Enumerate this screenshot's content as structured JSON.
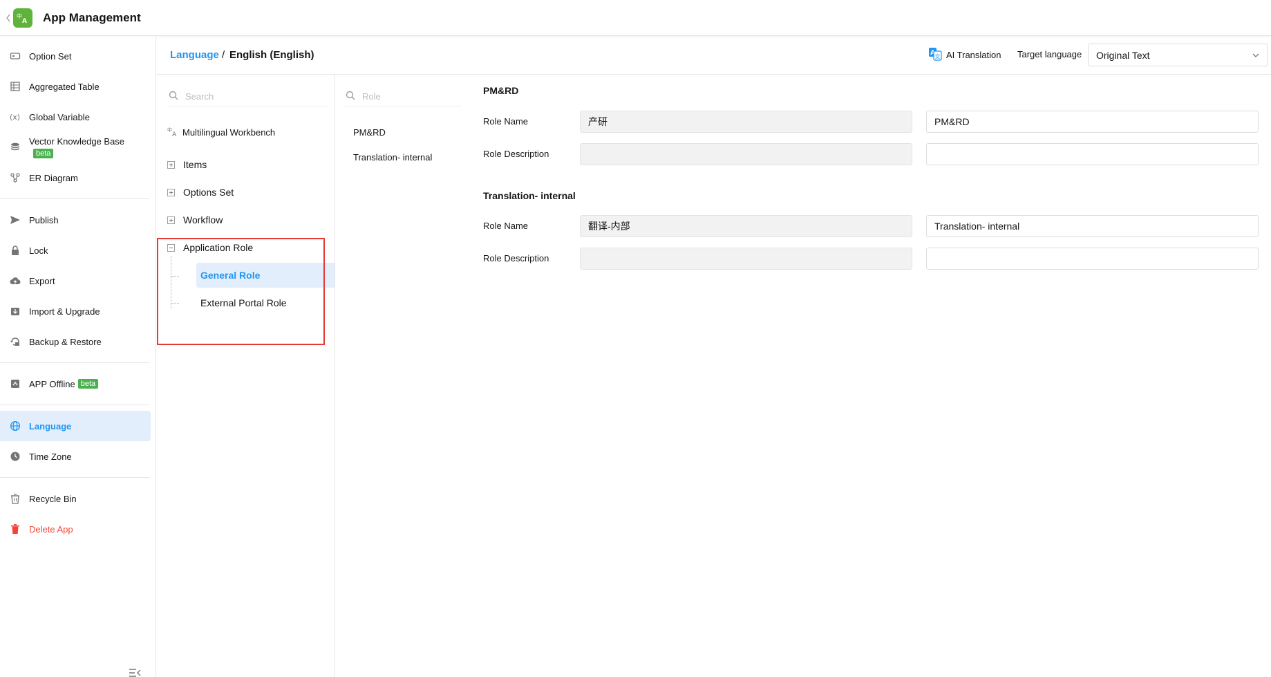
{
  "header": {
    "title": "App Management",
    "logo_color": "#5fb33b"
  },
  "sidebar": {
    "groups": [
      [
        {
          "label": "Option Set",
          "icon": "option-set-icon"
        },
        {
          "label": "Aggregated Table",
          "icon": "table-icon"
        },
        {
          "label": "Global Variable",
          "icon": "variable-icon"
        },
        {
          "label": "Vector Knowledge Base",
          "icon": "database-icon",
          "badge": "beta"
        },
        {
          "label": "ER Diagram",
          "icon": "er-diagram-icon"
        }
      ],
      [
        {
          "label": "Publish",
          "icon": "send-icon"
        },
        {
          "label": "Lock",
          "icon": "lock-icon"
        },
        {
          "label": "Export",
          "icon": "cloud-upload-icon"
        },
        {
          "label": "Import & Upgrade",
          "icon": "import-icon"
        },
        {
          "label": "Backup & Restore",
          "icon": "backup-icon"
        }
      ],
      [
        {
          "label": "APP Offline",
          "icon": "offline-icon",
          "badge": "beta"
        }
      ],
      [
        {
          "label": "Language",
          "icon": "globe-icon",
          "active": true
        },
        {
          "label": "Time Zone",
          "icon": "clock-icon"
        }
      ],
      [
        {
          "label": "Recycle Bin",
          "icon": "recycle-bin-icon"
        },
        {
          "label": "Delete App",
          "icon": "trash-icon",
          "danger": true
        }
      ]
    ]
  },
  "breadcrumb": {
    "link": "Language",
    "separator": "/",
    "current": "English (English)"
  },
  "toolbar": {
    "ai_translation_label": "AI Translation",
    "target_language_label": "Target language",
    "target_language_value": "Original Text"
  },
  "tree": {
    "search_placeholder": "Search",
    "workbench_label": "Multilingual Workbench",
    "nodes": [
      "Items",
      "Options Set",
      "Workflow"
    ],
    "expanded_node": "Application Role",
    "children": [
      {
        "label": "General Role",
        "active": true
      },
      {
        "label": "External Portal Role"
      }
    ]
  },
  "roles": {
    "search_placeholder": "Role",
    "items": [
      "PM&RD",
      "Translation- internal"
    ]
  },
  "form": {
    "sections": [
      {
        "title": "PM&RD",
        "role_name_label": "Role Name",
        "role_name_original": "产研",
        "role_name_translation": "PM&RD",
        "role_desc_label": "Role Description",
        "role_desc_original": "",
        "role_desc_translation": ""
      },
      {
        "title": "Translation- internal",
        "role_name_label": "Role Name",
        "role_name_original": "翻译-内部",
        "role_name_translation": "Translation- internal",
        "role_desc_label": "Role Description",
        "role_desc_original": "",
        "role_desc_translation": ""
      }
    ]
  },
  "colors": {
    "accent": "#2196f3",
    "active_bg": "#e3eefc",
    "danger": "#f44336",
    "badge": "#4caf50",
    "highlight": "#e53935"
  }
}
